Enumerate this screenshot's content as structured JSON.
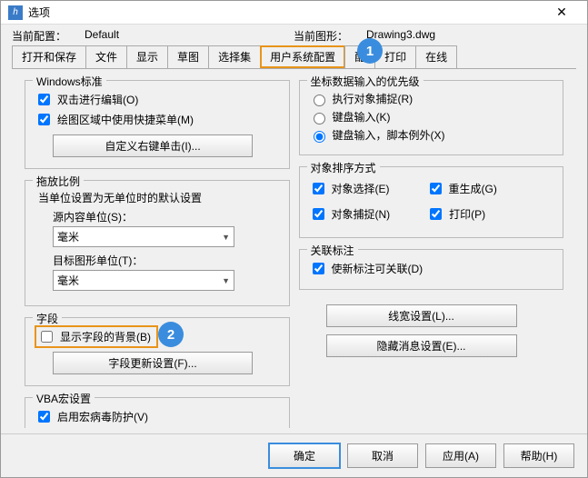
{
  "title": "选项",
  "profile": {
    "curLabel": "当前配置：",
    "curVal": "Default",
    "drwLabel": "当前图形：",
    "drwVal": "Drawing3.dwg"
  },
  "tabs": {
    "t0": "打开和保存",
    "t1": "文件",
    "t2": "显示",
    "t3": "草图",
    "t4": "选择集",
    "t5": "用户系统配置",
    "t6": "配",
    "t7": "打印",
    "t8": "在线"
  },
  "badges": {
    "b1": "1",
    "b2": "2"
  },
  "winStd": {
    "title": "Windows标准",
    "c1": "双击进行编辑(O)",
    "c2": "绘图区域中使用快捷菜单(M)",
    "btn": "自定义右键单击(I)..."
  },
  "scale": {
    "title": "拖放比例",
    "note": "当单位设置为无单位时的默认设置",
    "l1": "源内容单位(S)：",
    "v1": "毫米",
    "l2": "目标图形单位(T)：",
    "v2": "毫米"
  },
  "field": {
    "title": "字段",
    "c1": "显示字段的背景(B)",
    "btn": "字段更新设置(F)..."
  },
  "vba": {
    "title": "VBA宏设置",
    "c1": "启用宏病毒防护(V)"
  },
  "coord": {
    "title": "坐标数据输入的优先级",
    "r1": "执行对象捕捉(R)",
    "r2": "键盘输入(K)",
    "r3": "键盘输入，脚本例外(X)"
  },
  "sort": {
    "title": "对象排序方式",
    "c1": "对象选择(E)",
    "c2": "重生成(G)",
    "c3": "对象捕捉(N)",
    "c4": "打印(P)"
  },
  "assoc": {
    "title": "关联标注",
    "c1": "使新标注可关联(D)"
  },
  "btns": {
    "lw": "线宽设置(L)...",
    "hm": "隐藏消息设置(E)..."
  },
  "footer": {
    "ok": "确定",
    "cancel": "取消",
    "apply": "应用(A)",
    "help": "帮助(H)"
  }
}
